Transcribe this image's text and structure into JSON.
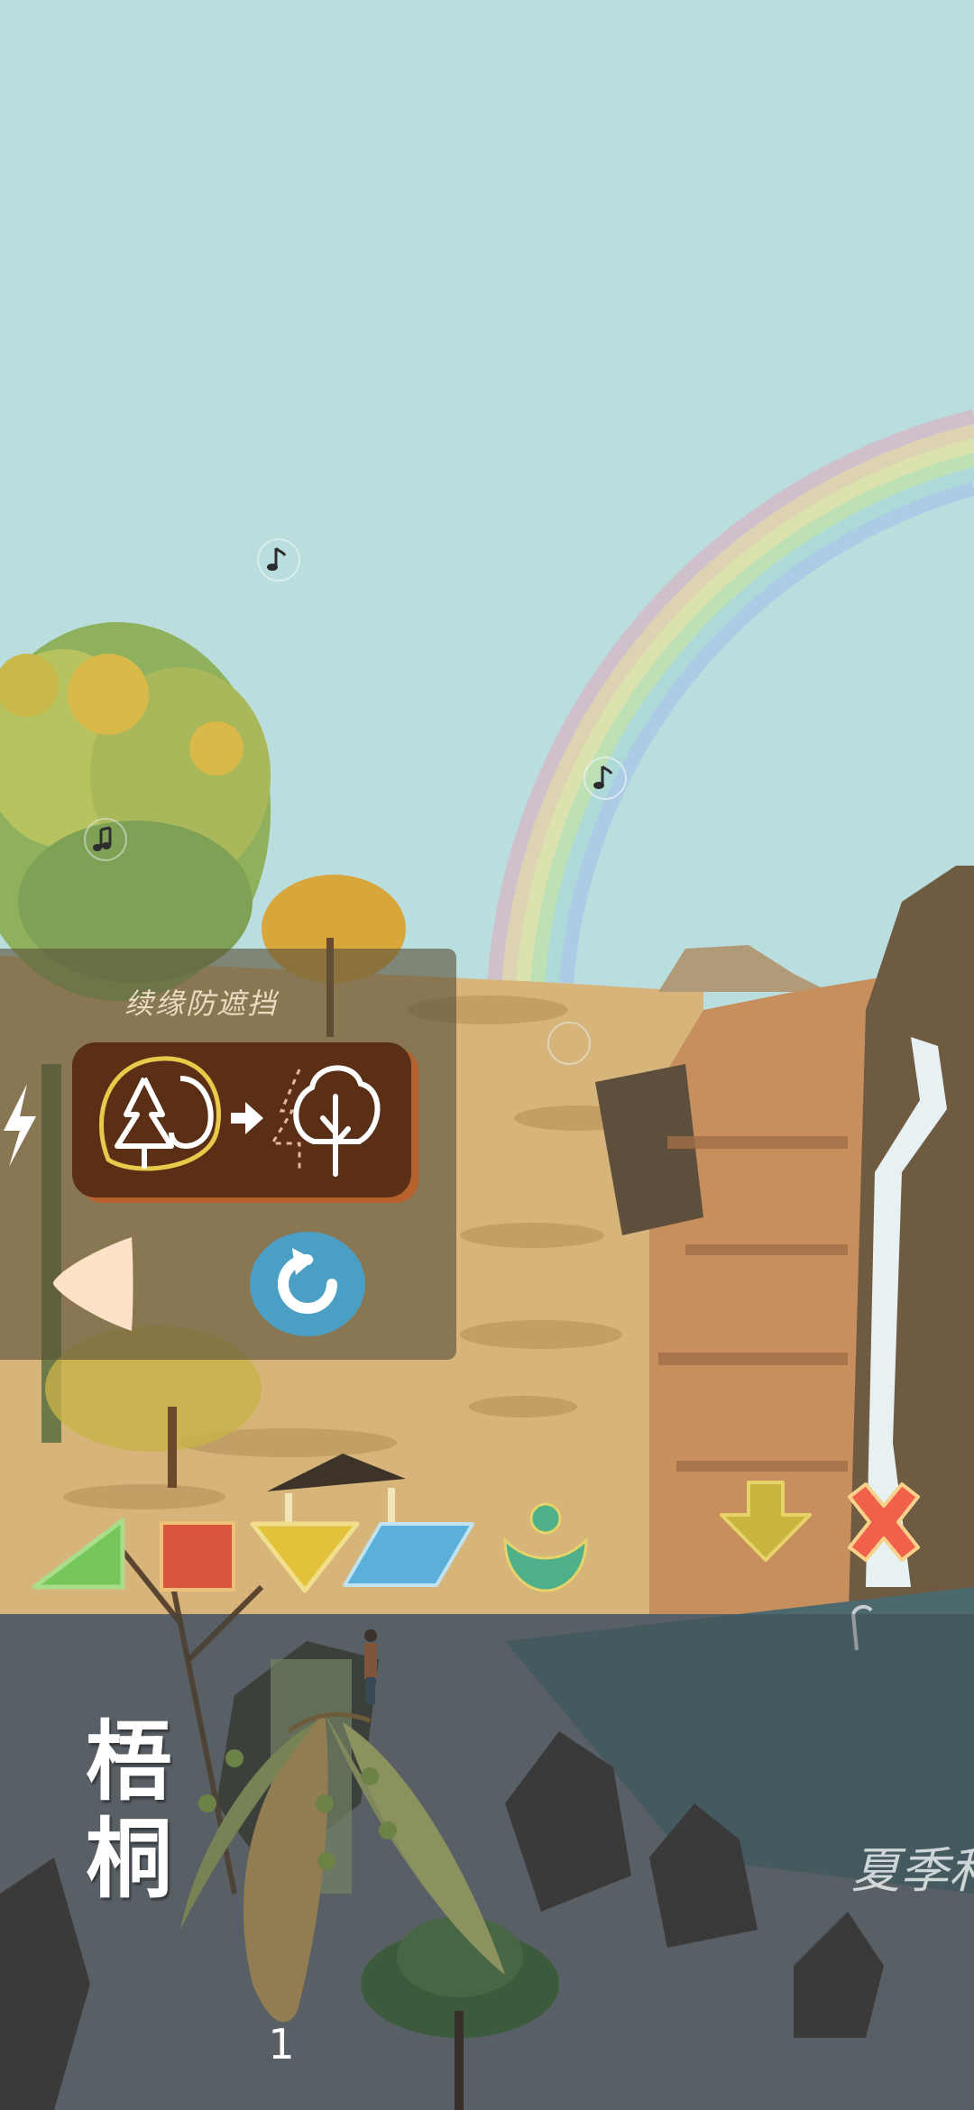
{
  "panel": {
    "title": "续缘防遮挡"
  },
  "specimen": {
    "name_line1": "梧",
    "name_line2": "桐",
    "season": "夏季和",
    "page": "1"
  },
  "icons": {
    "bolt": "lightning-icon",
    "back": "triangle-left-icon",
    "reset": "rotate-ccw-icon",
    "down": "arrow-down-icon",
    "close": "close-x-icon",
    "tree_swap": "tree-swap-icon",
    "note": "music-note-icon"
  },
  "colors": {
    "sky": "#b9dedd",
    "panel_card": "#5a2f16",
    "reset_blue": "#4b9fc4",
    "shape_green": "#76c75a",
    "shape_red": "#d8553e",
    "shape_yellow": "#e3c13a",
    "shape_blue": "#5ab0d8",
    "shape_teal": "#4fb08a",
    "close_red": "#f0604b",
    "down_olive": "#c9b43d"
  }
}
